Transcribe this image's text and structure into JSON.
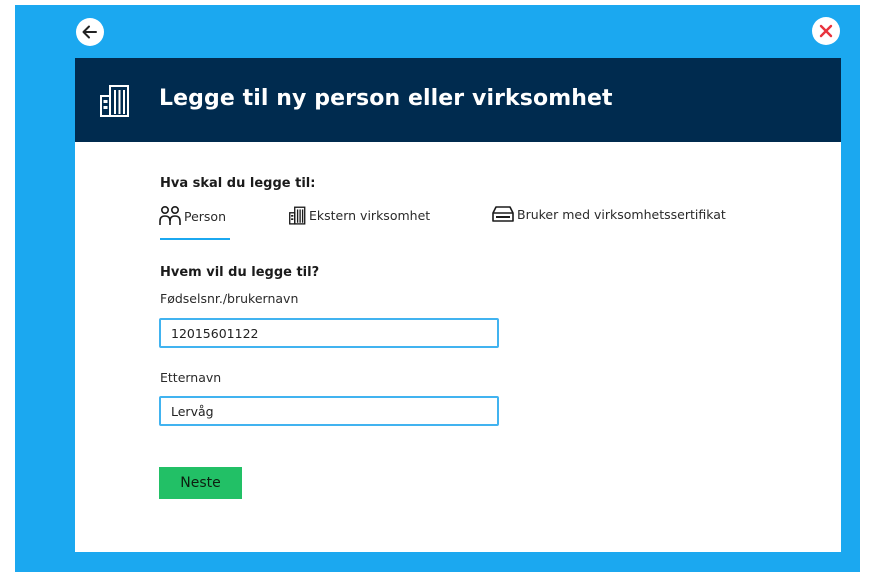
{
  "window": {
    "back_button_icon": "arrow-left-icon",
    "close_button_icon": "close-icon",
    "colors": {
      "frame_background": "#1ba8f0",
      "header_background": "#002b4f",
      "close_icon": "#e8333d",
      "tab_underline": "#1ba8f0",
      "field_border": "#41b3f0",
      "button_background": "#22c066"
    }
  },
  "header": {
    "icon": "building-icon",
    "title": "Legge til ny person eller virksomhet"
  },
  "type_section": {
    "heading": "Hva skal du legge til:",
    "selected_tab": "Person",
    "tabs": [
      {
        "label": "Person",
        "icon": "person-icon"
      },
      {
        "label": "Ekstern virksomhet",
        "icon": "building-icon"
      },
      {
        "label": "Bruker med virksomhetssertifikat",
        "icon": "certificate-icon"
      }
    ]
  },
  "who_section": {
    "heading": "Hvem vil du legge til?"
  },
  "form": {
    "id_label": "Fødselsnr./brukernavn",
    "id_value": "12015601122",
    "lastname_label": "Etternavn",
    "lastname_value": "Lervåg",
    "next_button": "Neste"
  }
}
